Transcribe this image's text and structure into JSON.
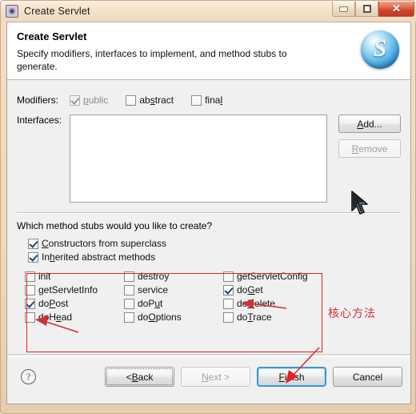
{
  "window": {
    "title": "Create Servlet",
    "title_icon": "gear-icon",
    "minimize_label": "",
    "maximize_label": "",
    "close_label": "✕"
  },
  "header": {
    "title": "Create Servlet",
    "description": "Specify modifiers, interfaces to implement, and method stubs to generate.",
    "icon": "servlet-sphere-icon"
  },
  "modifiers": {
    "label": "Modifiers:",
    "items": [
      {
        "label": "public",
        "checked": true,
        "disabled": true
      },
      {
        "label": "abstract",
        "checked": false,
        "disabled": false
      },
      {
        "label": "final",
        "checked": false,
        "disabled": false
      }
    ]
  },
  "interfaces": {
    "label": "Interfaces:",
    "list_items": [],
    "add_label": "Add...",
    "remove_label": "Remove",
    "remove_disabled": true
  },
  "stubs": {
    "question": "Which method stubs would you like to create?",
    "top_options": [
      {
        "label": "Constructors from superclass",
        "checked": true
      },
      {
        "label": "Inherited abstract methods",
        "checked": true
      }
    ],
    "methods": [
      {
        "label": "init",
        "checked": false
      },
      {
        "label": "destroy",
        "checked": false
      },
      {
        "label": "getServletConfig",
        "checked": false
      },
      {
        "label": "getServletInfo",
        "checked": false
      },
      {
        "label": "service",
        "checked": false
      },
      {
        "label": "doGet",
        "checked": true
      },
      {
        "label": "doPost",
        "checked": true
      },
      {
        "label": "doPut",
        "checked": false
      },
      {
        "label": "doDelete",
        "checked": false
      },
      {
        "label": "doHead",
        "checked": false
      },
      {
        "label": "doOptions",
        "checked": false
      },
      {
        "label": "doTrace",
        "checked": false
      }
    ]
  },
  "annotation": {
    "text": "核心方法",
    "color": "#d3303a"
  },
  "footer": {
    "help_label": "?",
    "back_label": "< Back",
    "next_label": "Next >",
    "finish_label": "Finish",
    "cancel_label": "Cancel",
    "next_disabled": true,
    "finish_focused": true
  }
}
